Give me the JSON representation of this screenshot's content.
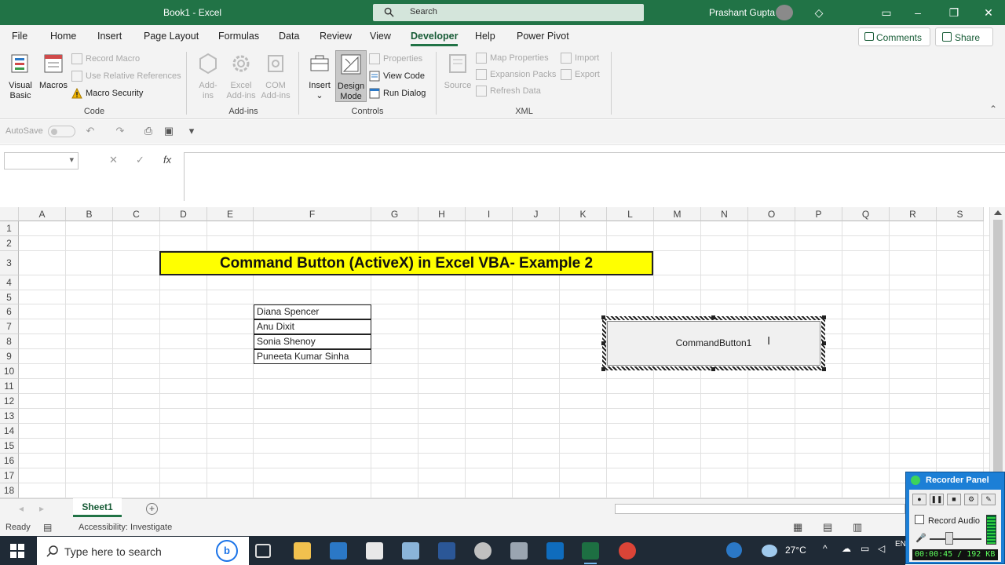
{
  "window": {
    "title": "Book1  -  Excel",
    "search_placeholder": "Search",
    "user_name": "Prashant Gupta"
  },
  "menu": {
    "tabs": [
      "File",
      "Home",
      "Insert",
      "Page Layout",
      "Formulas",
      "Data",
      "Review",
      "View",
      "Developer",
      "Help",
      "Power Pivot"
    ],
    "active_tab": "Developer",
    "comments_label": "Comments",
    "share_label": "Share"
  },
  "ribbon": {
    "code": {
      "visual_basic": "Visual Basic",
      "macros": "Macros",
      "record_macro": "Record Macro",
      "relative_refs": "Use Relative References",
      "macro_security": "Macro Security",
      "group_label": "Code"
    },
    "addins": {
      "addins": "Add-ins",
      "excel_addins": "Excel Add-ins",
      "com_addins": "COM Add-ins",
      "group_label": "Add-ins"
    },
    "controls": {
      "insert": "Insert",
      "design_mode": "Design Mode",
      "properties": "Properties",
      "view_code": "View Code",
      "run_dialog": "Run Dialog",
      "group_label": "Controls"
    },
    "xml": {
      "source": "Source",
      "map_properties": "Map Properties",
      "expansion_packs": "Expansion Packs",
      "refresh_data": "Refresh Data",
      "import": "Import",
      "export": "Export",
      "group_label": "XML"
    }
  },
  "qat": {
    "autosave_label": "AutoSave",
    "autosave_state": "off"
  },
  "formula_bar": {
    "name_box": "",
    "fx": "fx",
    "formula": ""
  },
  "sheet": {
    "columns": [
      "A",
      "B",
      "C",
      "D",
      "E",
      "F",
      "G",
      "H",
      "I",
      "J",
      "K",
      "L",
      "M",
      "N",
      "O",
      "P",
      "Q",
      "R",
      "S"
    ],
    "rows": [
      "1",
      "2",
      "3",
      "4",
      "5",
      "6",
      "7",
      "8",
      "9",
      "10",
      "11",
      "12",
      "13",
      "14",
      "15",
      "16",
      "17",
      "18"
    ],
    "title": "Command Button (ActiveX) in Excel VBA- Example 2",
    "names": [
      "Diana Spencer",
      "Anu Dixit",
      "Sonia Shenoy",
      "Puneeta Kumar Sinha"
    ],
    "command_button": "CommandButton1",
    "active_sheet_tab": "Sheet1"
  },
  "status": {
    "ready": "Ready",
    "accessibility": "Accessibility: Investigate"
  },
  "recorder": {
    "title": "Recorder Panel",
    "record_audio": "Record Audio",
    "timer": "00:00:45 / 192 KB"
  },
  "taskbar": {
    "search_placeholder": "Type here to search",
    "temperature": "27°C",
    "lang": "EN"
  },
  "colors": {
    "excel_green": "#217346",
    "title_fill": "#ffff00",
    "ribbon_bg": "#f3f3f3",
    "taskbar_bg": "#1f2a36",
    "recorder_blue": "#1c7fd6"
  }
}
